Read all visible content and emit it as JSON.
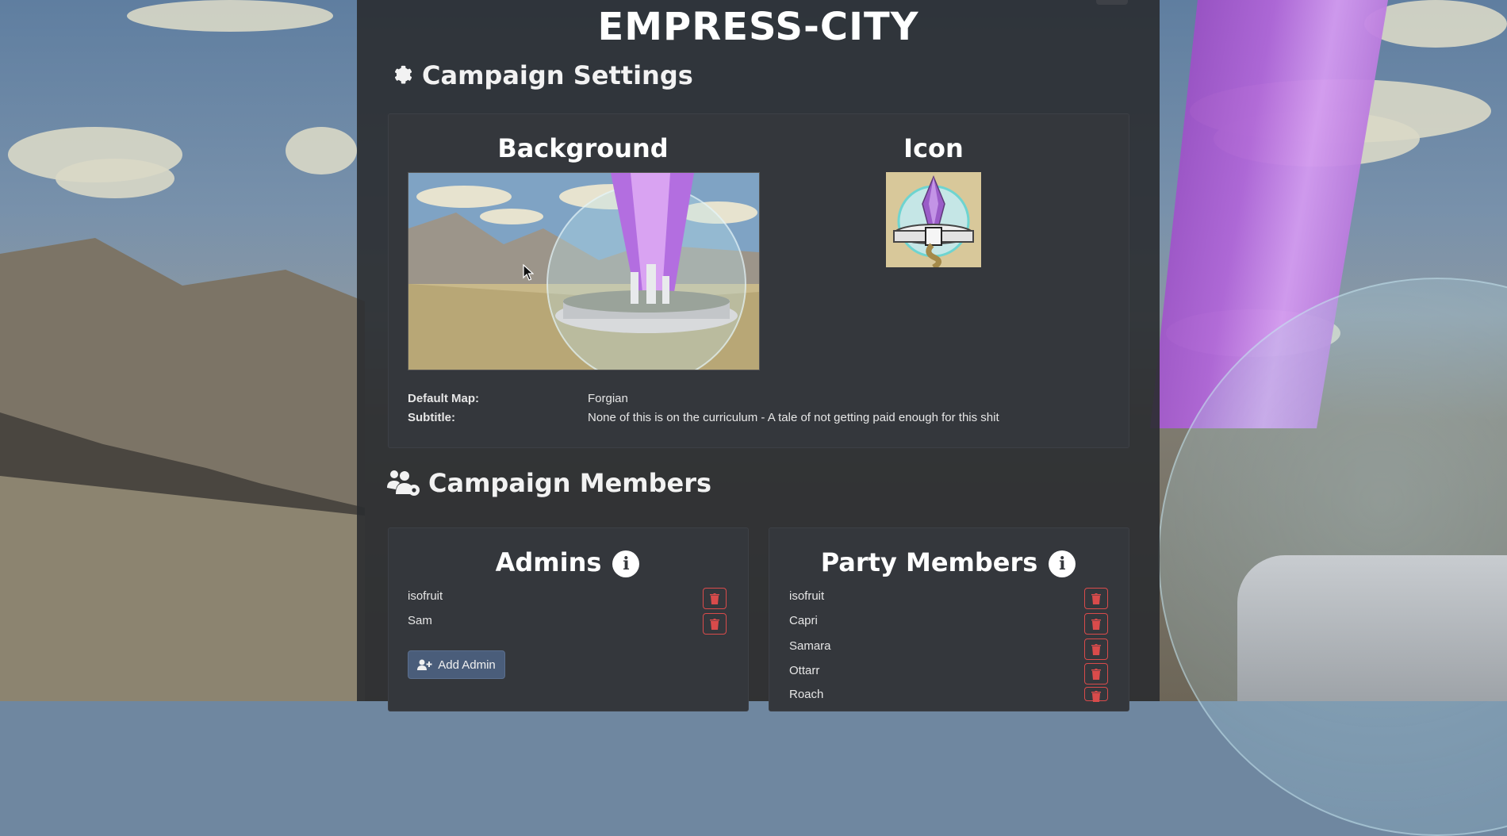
{
  "campaign": {
    "title": "EMPRESS-CITY"
  },
  "settings": {
    "heading": "Campaign Settings",
    "background_heading": "Background",
    "icon_heading": "Icon",
    "default_map_label": "Default Map:",
    "default_map_value": "Forgian",
    "subtitle_label": "Subtitle:",
    "subtitle_value": "None of this is on the curriculum - A tale of not getting paid enough for this shit"
  },
  "members": {
    "heading": "Campaign Members",
    "admins": {
      "heading": "Admins",
      "items": [
        "isofruit",
        "Sam"
      ],
      "add_label": "Add Admin"
    },
    "party": {
      "heading": "Party Members",
      "items": [
        "isofruit",
        "Capri",
        "Samara",
        "Ottarr",
        "Roach"
      ]
    }
  },
  "icons": [
    "gear-icon",
    "users-gear-icon",
    "info-icon",
    "trash-icon",
    "user-plus-icon"
  ],
  "colors": {
    "panel": "#2a2c30",
    "card": "#34373c",
    "danger": "#d94b4b",
    "button": "#4a5d7a"
  }
}
